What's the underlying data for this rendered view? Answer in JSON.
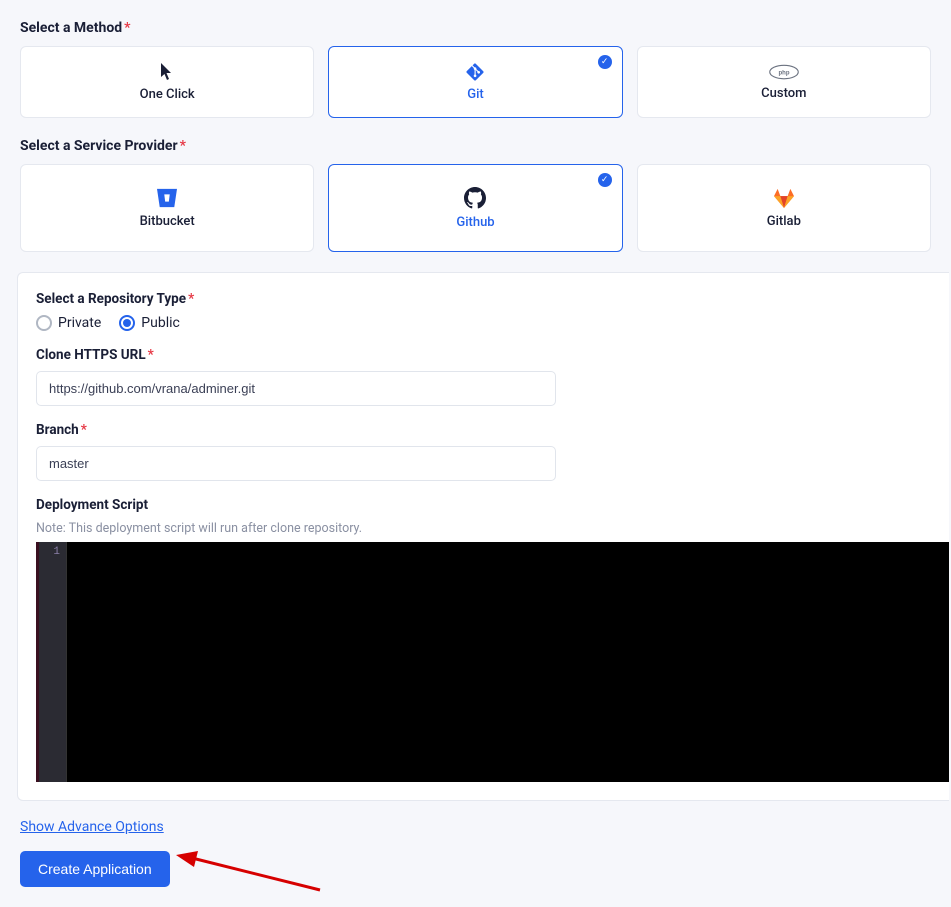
{
  "method": {
    "label": "Select a Method",
    "options": [
      {
        "label": "One Click",
        "icon": "cursor-icon",
        "selected": false
      },
      {
        "label": "Git",
        "icon": "git-icon",
        "selected": true
      },
      {
        "label": "Custom",
        "icon": "php-icon",
        "selected": false
      }
    ]
  },
  "provider": {
    "label": "Select a Service Provider",
    "options": [
      {
        "label": "Bitbucket",
        "icon": "bitbucket-icon",
        "selected": false
      },
      {
        "label": "Github",
        "icon": "github-icon",
        "selected": true
      },
      {
        "label": "Gitlab",
        "icon": "gitlab-icon",
        "selected": false
      }
    ]
  },
  "repo_type": {
    "label": "Select a Repository Type",
    "options": [
      {
        "label": "Private",
        "selected": false
      },
      {
        "label": "Public",
        "selected": true
      }
    ]
  },
  "clone_url": {
    "label": "Clone HTTPS URL",
    "value": "https://github.com/vrana/adminer.git"
  },
  "branch": {
    "label": "Branch",
    "value": "master"
  },
  "script": {
    "label": "Deployment Script",
    "note": "Note: This deployment script will run after clone repository.",
    "line_number": "1"
  },
  "advance_link": "Show Advance Options",
  "create_button": "Create Application"
}
